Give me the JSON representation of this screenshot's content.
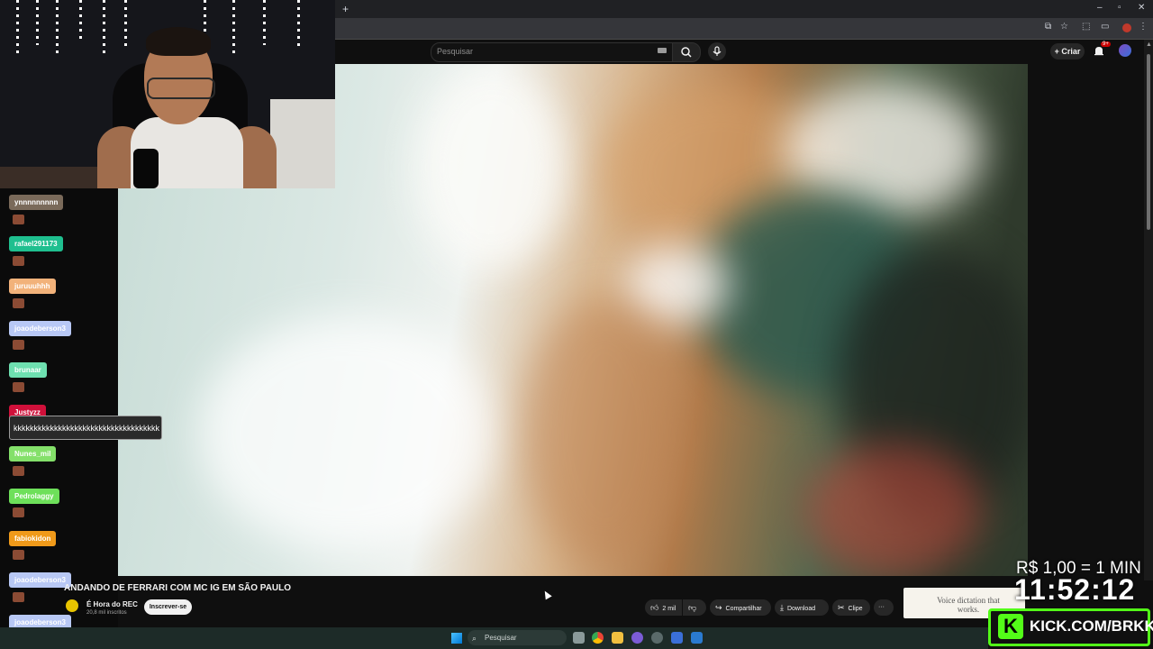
{
  "browser": {
    "new_tab": "+",
    "window_controls": [
      "–",
      "▫",
      "✕"
    ]
  },
  "youtube": {
    "search_placeholder": "Pesquisar",
    "create_label": "+ Criar",
    "notifications_badge": "9+"
  },
  "video": {
    "title": "ANDANDO DE FERRARI COM MC IG EM SÃO PAULO",
    "channel_name": "É Hora do REC",
    "subscribers": "20,8 mil inscritos",
    "subscribe_label": "Inscrever-se",
    "likes": "2 mil",
    "share_label": "Compartilhar",
    "download_label": "Download",
    "clip_label": "Clipe",
    "more_label": "···"
  },
  "ad": {
    "text": "Voice dictation that works."
  },
  "chat": {
    "users": [
      {
        "name": "ynnnnnnnnn",
        "color": "#7a6a5a"
      },
      {
        "name": "rafael291173",
        "color": "#1fbf8f"
      },
      {
        "name": "juruuuhhh",
        "color": "#f2b27a"
      },
      {
        "name": "joaodeberson3",
        "color": "#b8c8f5"
      },
      {
        "name": "brunaar",
        "color": "#6ee0b0"
      },
      {
        "name": "Justyzz",
        "color": "#d0103a"
      },
      {
        "name": "Nunes_mil",
        "color": "#84e06a"
      },
      {
        "name": "Pedrolaggy",
        "color": "#6ee05a"
      },
      {
        "name": "fabiokidon",
        "color": "#f09a1a"
      },
      {
        "name": "joaodeberson3",
        "color": "#b8c8f5"
      },
      {
        "name": "joaodeberson3",
        "color": "#b8c8f5"
      }
    ],
    "message": "kkkkkkkkkkkkkkkkkkkkkkkkkkkkkkkkkkkk"
  },
  "overlay": {
    "donation": "R$ 1,00 = 1 MIN",
    "timer": "11:52:12",
    "kick_url": "KICK.COM/BRKK",
    "kick_logo": "K"
  },
  "taskbar": {
    "search_label": "Pesquisar"
  },
  "colors": {
    "kick_green": "#53fc18",
    "youtube_bg": "#0f0f0f"
  }
}
